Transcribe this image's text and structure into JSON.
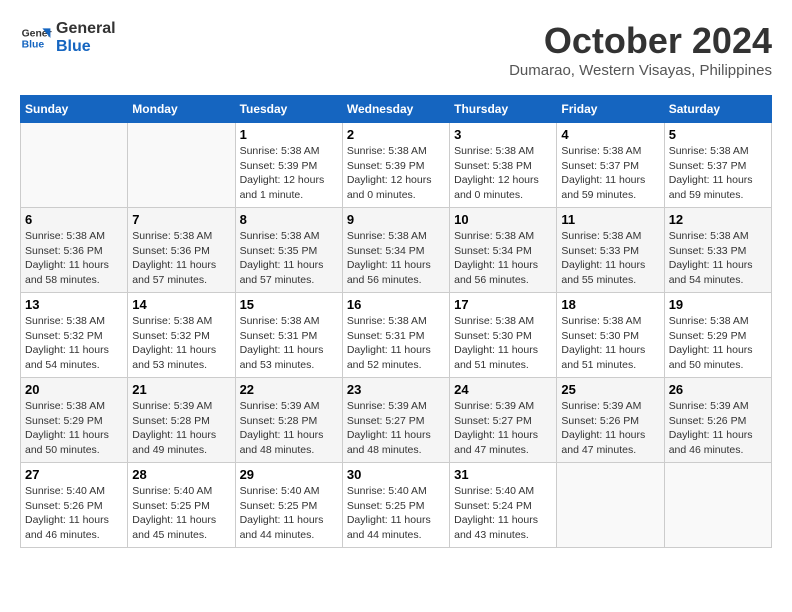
{
  "header": {
    "logo_line1": "General",
    "logo_line2": "Blue",
    "month_title": "October 2024",
    "location": "Dumarao, Western Visayas, Philippines"
  },
  "days_of_week": [
    "Sunday",
    "Monday",
    "Tuesday",
    "Wednesday",
    "Thursday",
    "Friday",
    "Saturday"
  ],
  "weeks": [
    [
      {
        "day": "",
        "info": ""
      },
      {
        "day": "",
        "info": ""
      },
      {
        "day": "1",
        "info": "Sunrise: 5:38 AM\nSunset: 5:39 PM\nDaylight: 12 hours\nand 1 minute."
      },
      {
        "day": "2",
        "info": "Sunrise: 5:38 AM\nSunset: 5:39 PM\nDaylight: 12 hours\nand 0 minutes."
      },
      {
        "day": "3",
        "info": "Sunrise: 5:38 AM\nSunset: 5:38 PM\nDaylight: 12 hours\nand 0 minutes."
      },
      {
        "day": "4",
        "info": "Sunrise: 5:38 AM\nSunset: 5:37 PM\nDaylight: 11 hours\nand 59 minutes."
      },
      {
        "day": "5",
        "info": "Sunrise: 5:38 AM\nSunset: 5:37 PM\nDaylight: 11 hours\nand 59 minutes."
      }
    ],
    [
      {
        "day": "6",
        "info": "Sunrise: 5:38 AM\nSunset: 5:36 PM\nDaylight: 11 hours\nand 58 minutes."
      },
      {
        "day": "7",
        "info": "Sunrise: 5:38 AM\nSunset: 5:36 PM\nDaylight: 11 hours\nand 57 minutes."
      },
      {
        "day": "8",
        "info": "Sunrise: 5:38 AM\nSunset: 5:35 PM\nDaylight: 11 hours\nand 57 minutes."
      },
      {
        "day": "9",
        "info": "Sunrise: 5:38 AM\nSunset: 5:34 PM\nDaylight: 11 hours\nand 56 minutes."
      },
      {
        "day": "10",
        "info": "Sunrise: 5:38 AM\nSunset: 5:34 PM\nDaylight: 11 hours\nand 56 minutes."
      },
      {
        "day": "11",
        "info": "Sunrise: 5:38 AM\nSunset: 5:33 PM\nDaylight: 11 hours\nand 55 minutes."
      },
      {
        "day": "12",
        "info": "Sunrise: 5:38 AM\nSunset: 5:33 PM\nDaylight: 11 hours\nand 54 minutes."
      }
    ],
    [
      {
        "day": "13",
        "info": "Sunrise: 5:38 AM\nSunset: 5:32 PM\nDaylight: 11 hours\nand 54 minutes."
      },
      {
        "day": "14",
        "info": "Sunrise: 5:38 AM\nSunset: 5:32 PM\nDaylight: 11 hours\nand 53 minutes."
      },
      {
        "day": "15",
        "info": "Sunrise: 5:38 AM\nSunset: 5:31 PM\nDaylight: 11 hours\nand 53 minutes."
      },
      {
        "day": "16",
        "info": "Sunrise: 5:38 AM\nSunset: 5:31 PM\nDaylight: 11 hours\nand 52 minutes."
      },
      {
        "day": "17",
        "info": "Sunrise: 5:38 AM\nSunset: 5:30 PM\nDaylight: 11 hours\nand 51 minutes."
      },
      {
        "day": "18",
        "info": "Sunrise: 5:38 AM\nSunset: 5:30 PM\nDaylight: 11 hours\nand 51 minutes."
      },
      {
        "day": "19",
        "info": "Sunrise: 5:38 AM\nSunset: 5:29 PM\nDaylight: 11 hours\nand 50 minutes."
      }
    ],
    [
      {
        "day": "20",
        "info": "Sunrise: 5:38 AM\nSunset: 5:29 PM\nDaylight: 11 hours\nand 50 minutes."
      },
      {
        "day": "21",
        "info": "Sunrise: 5:39 AM\nSunset: 5:28 PM\nDaylight: 11 hours\nand 49 minutes."
      },
      {
        "day": "22",
        "info": "Sunrise: 5:39 AM\nSunset: 5:28 PM\nDaylight: 11 hours\nand 48 minutes."
      },
      {
        "day": "23",
        "info": "Sunrise: 5:39 AM\nSunset: 5:27 PM\nDaylight: 11 hours\nand 48 minutes."
      },
      {
        "day": "24",
        "info": "Sunrise: 5:39 AM\nSunset: 5:27 PM\nDaylight: 11 hours\nand 47 minutes."
      },
      {
        "day": "25",
        "info": "Sunrise: 5:39 AM\nSunset: 5:26 PM\nDaylight: 11 hours\nand 47 minutes."
      },
      {
        "day": "26",
        "info": "Sunrise: 5:39 AM\nSunset: 5:26 PM\nDaylight: 11 hours\nand 46 minutes."
      }
    ],
    [
      {
        "day": "27",
        "info": "Sunrise: 5:40 AM\nSunset: 5:26 PM\nDaylight: 11 hours\nand 46 minutes."
      },
      {
        "day": "28",
        "info": "Sunrise: 5:40 AM\nSunset: 5:25 PM\nDaylight: 11 hours\nand 45 minutes."
      },
      {
        "day": "29",
        "info": "Sunrise: 5:40 AM\nSunset: 5:25 PM\nDaylight: 11 hours\nand 44 minutes."
      },
      {
        "day": "30",
        "info": "Sunrise: 5:40 AM\nSunset: 5:25 PM\nDaylight: 11 hours\nand 44 minutes."
      },
      {
        "day": "31",
        "info": "Sunrise: 5:40 AM\nSunset: 5:24 PM\nDaylight: 11 hours\nand 43 minutes."
      },
      {
        "day": "",
        "info": ""
      },
      {
        "day": "",
        "info": ""
      }
    ]
  ]
}
